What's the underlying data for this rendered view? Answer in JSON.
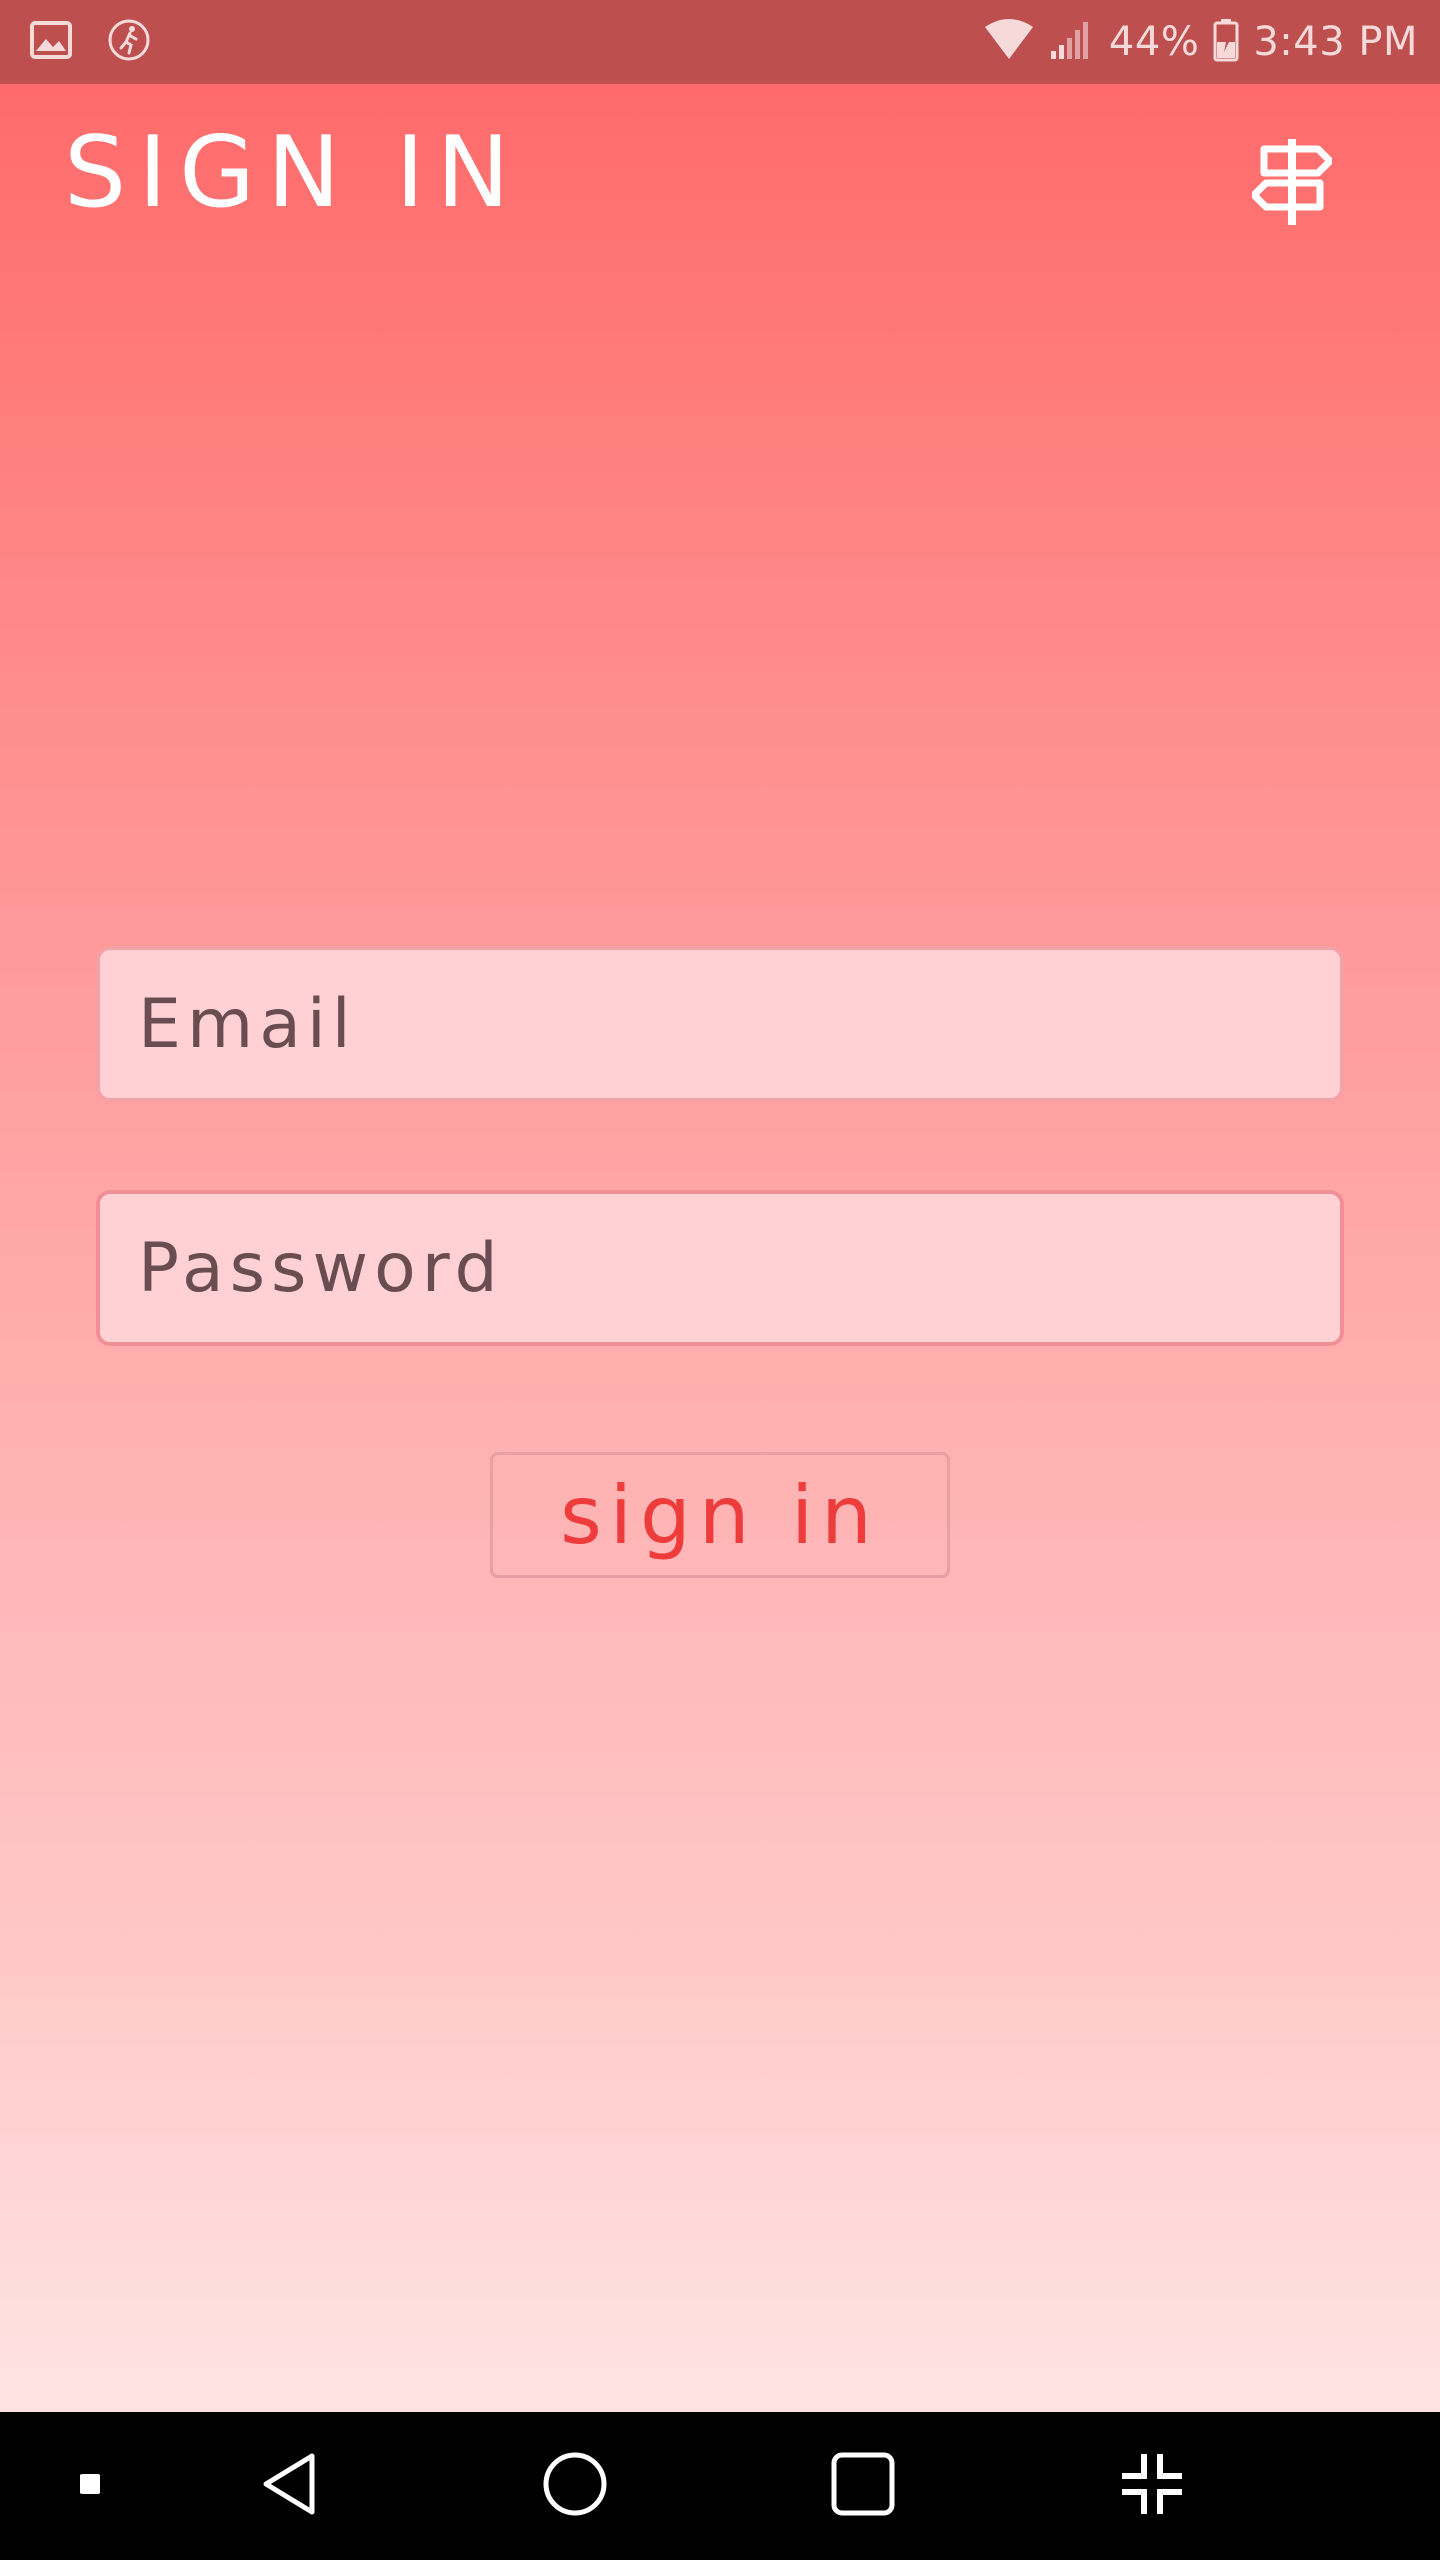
{
  "status_bar": {
    "left_icons": [
      "gallery-icon",
      "activity-icon"
    ],
    "right_icons": [
      "wifi-icon",
      "signal-icon",
      "battery-charging-icon"
    ],
    "battery_percent": "44%",
    "time": "3:43 PM"
  },
  "header": {
    "title": "SIGN IN",
    "action_icon": "signpost-icon"
  },
  "form": {
    "email": {
      "placeholder": "Email",
      "value": ""
    },
    "password": {
      "placeholder": "Password",
      "value": ""
    },
    "submit_label": "sign in"
  },
  "nav_bar": {
    "buttons": [
      "menu-dot-icon",
      "back-icon",
      "home-icon",
      "recents-icon",
      "exit-fullscreen-icon"
    ]
  },
  "colors": {
    "status_bar": "#bd4f4f",
    "gradient_top": "#ff6666",
    "gradient_bottom": "#ffecec",
    "field_fill": "#ffd1d5",
    "button_text": "#ee3b3b"
  }
}
